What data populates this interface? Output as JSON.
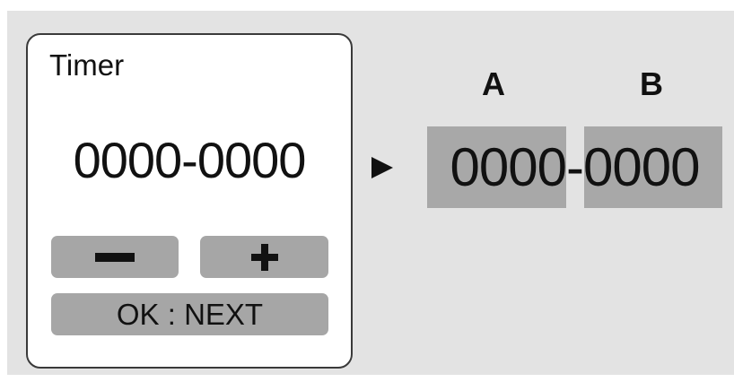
{
  "timer_panel": {
    "title": "Timer",
    "value": "0000-0000",
    "decrement_button": {
      "icon": "minus-icon"
    },
    "increment_button": {
      "icon": "plus-icon"
    },
    "ok_button": {
      "label": "OK : NEXT"
    }
  },
  "arrow": {
    "icon": "right-arrow-icon"
  },
  "result": {
    "label_a": "A",
    "label_b": "B",
    "value": "0000-0000",
    "highlight_color": "#a8a8a8"
  }
}
